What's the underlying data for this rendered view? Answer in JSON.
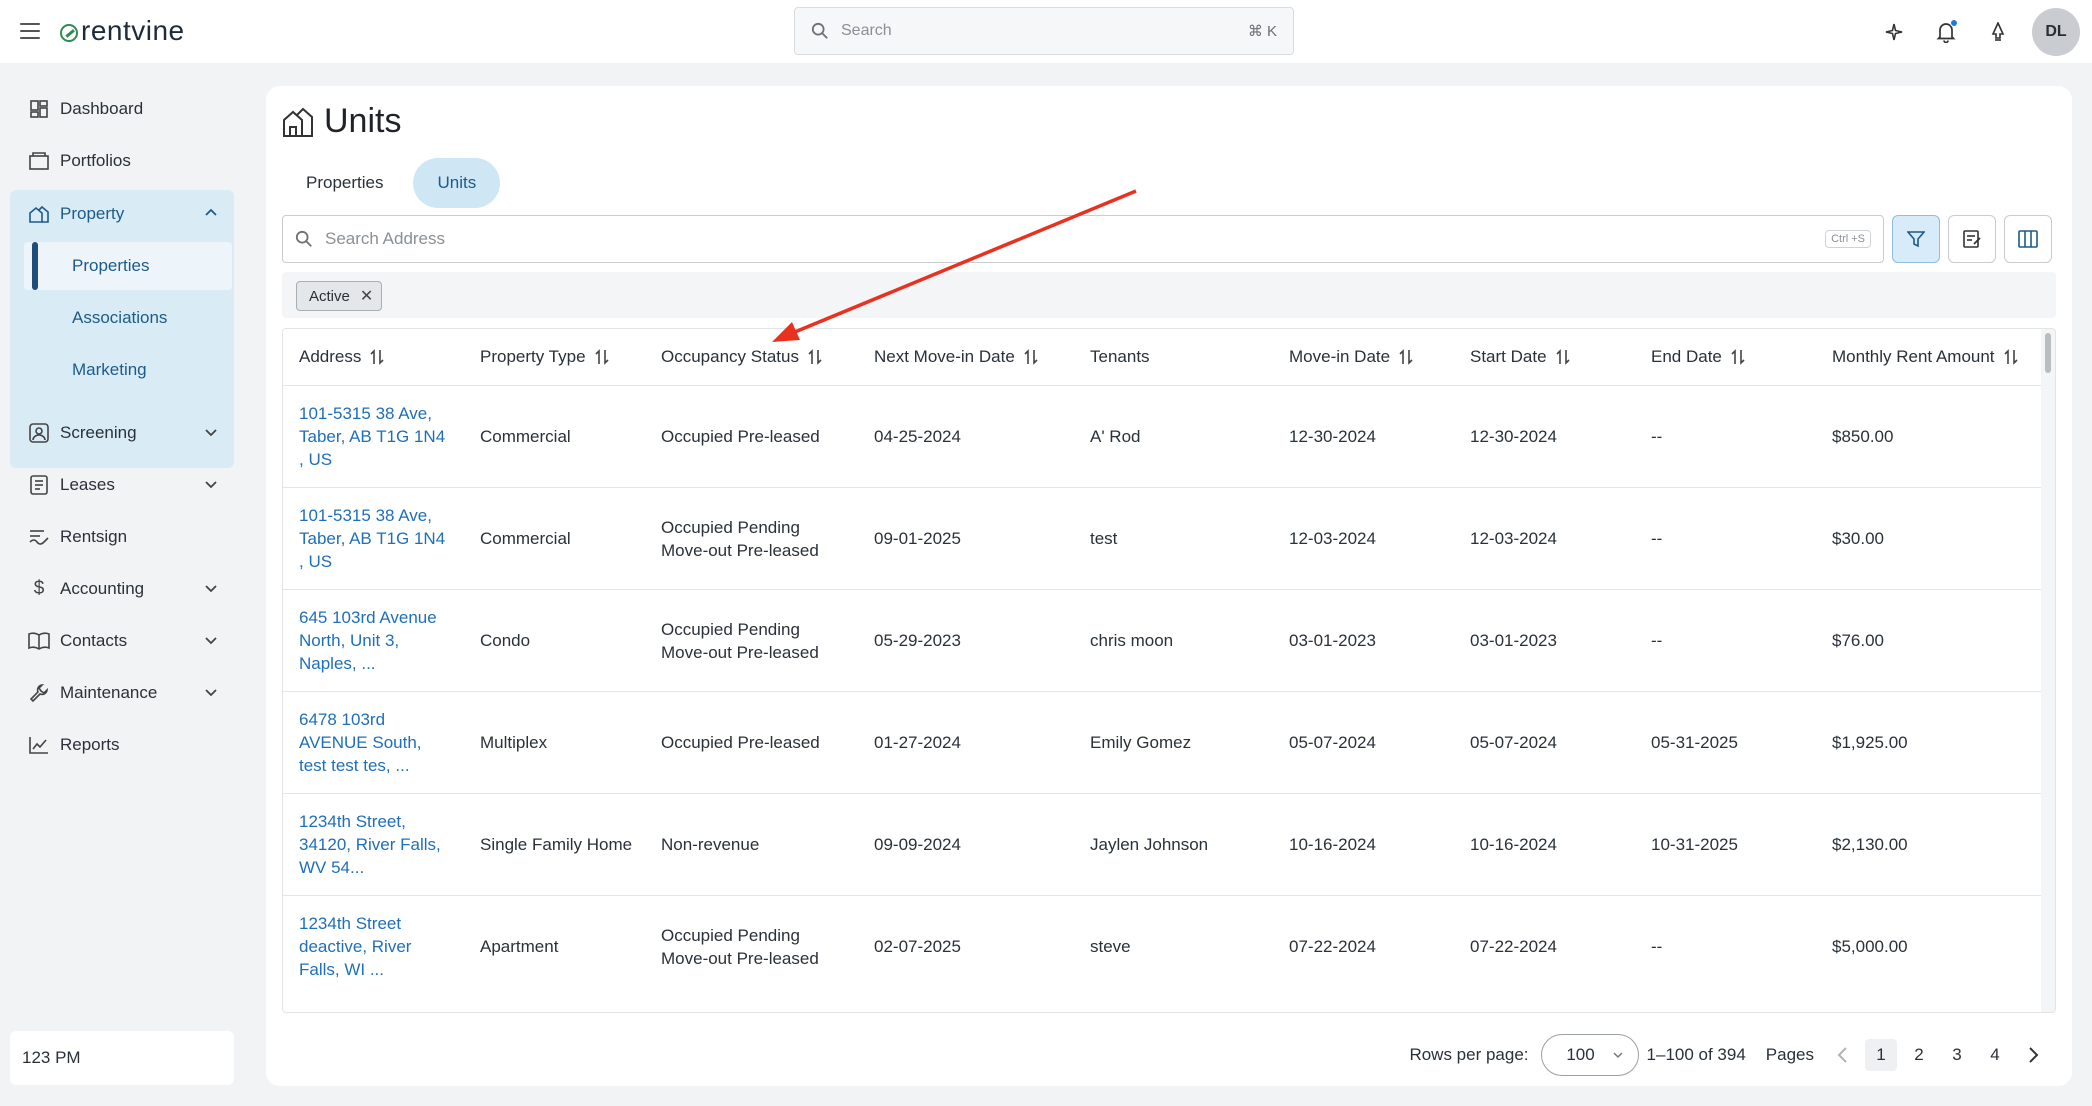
{
  "app": {
    "brand": "rentvine",
    "search_placeholder": "Search",
    "search_shortcut": "⌘ K",
    "avatar_initials": "DL"
  },
  "sidebar": {
    "items": [
      {
        "label": "Dashboard",
        "icon": "dashboard-icon"
      },
      {
        "label": "Portfolios",
        "icon": "portfolio-icon"
      },
      {
        "label": "Property",
        "icon": "property-icon",
        "expanded": true,
        "children": [
          "Properties",
          "Associations",
          "Marketing"
        ]
      },
      {
        "label": "Screening",
        "icon": "screening-icon",
        "has_chevron": true
      },
      {
        "label": "Leases",
        "icon": "leases-icon",
        "has_chevron": true
      },
      {
        "label": "Rentsign",
        "icon": "rentsign-icon"
      },
      {
        "label": "Accounting",
        "icon": "dollar-icon",
        "has_chevron": true
      },
      {
        "label": "Contacts",
        "icon": "contacts-icon",
        "has_chevron": true
      },
      {
        "label": "Maintenance",
        "icon": "wrench-icon",
        "has_chevron": true
      },
      {
        "label": "Reports",
        "icon": "reports-icon"
      }
    ],
    "active_child": "Properties",
    "user_label": "123 PM"
  },
  "page": {
    "title": "Units",
    "tabs": [
      "Properties",
      "Units"
    ],
    "active_tab": "Units",
    "search_placeholder": "Search Address",
    "search_shortcut": "Ctrl +S",
    "filter_chip": "Active"
  },
  "table": {
    "columns": [
      "Address",
      "Property Type",
      "Occupancy Status",
      "Next Move-in Date",
      "Tenants",
      "Move-in Date",
      "Start Date",
      "End Date",
      "Monthly Rent Amount"
    ],
    "sortable": [
      true,
      true,
      true,
      true,
      false,
      true,
      true,
      true,
      true
    ],
    "rows": [
      {
        "address": [
          "101-5315 38 Ave,",
          "Taber, AB T1G 1N4",
          ", US"
        ],
        "type": "Commercial",
        "status": [
          "Occupied Pre-leased"
        ],
        "next_move_in": "04-25-2024",
        "tenants": "A' Rod",
        "move_in": "12-30-2024",
        "start": "12-30-2024",
        "end": "--",
        "rent": "$850.00"
      },
      {
        "address": [
          "101-5315 38 Ave,",
          "Taber, AB T1G 1N4",
          ", US"
        ],
        "type": "Commercial",
        "status": [
          "Occupied Pending",
          "Move-out Pre-leased"
        ],
        "next_move_in": "09-01-2025",
        "tenants": "test",
        "move_in": "12-03-2024",
        "start": "12-03-2024",
        "end": "--",
        "rent": "$30.00"
      },
      {
        "address": [
          "645 103rd Avenue",
          "North, Unit 3,",
          "Naples, ..."
        ],
        "type": "Condo",
        "status": [
          "Occupied Pending",
          "Move-out Pre-leased"
        ],
        "next_move_in": "05-29-2023",
        "tenants": "chris moon",
        "move_in": "03-01-2023",
        "start": "03-01-2023",
        "end": "--",
        "rent": "$76.00"
      },
      {
        "address": [
          "6478 103rd",
          "AVENUE South,",
          "test test tes, ..."
        ],
        "type": "Multiplex",
        "status": [
          "Occupied Pre-leased"
        ],
        "next_move_in": "01-27-2024",
        "tenants": "Emily Gomez",
        "move_in": "05-07-2024",
        "start": "05-07-2024",
        "end": "05-31-2025",
        "rent": "$1,925.00"
      },
      {
        "address": [
          "1234th Street,",
          "34120, River Falls,",
          "WV 54..."
        ],
        "type": "Single Family Home",
        "status": [
          "Non-revenue"
        ],
        "next_move_in": "09-09-2024",
        "tenants": "Jaylen Johnson",
        "move_in": "10-16-2024",
        "start": "10-16-2024",
        "end": "10-31-2025",
        "rent": "$2,130.00"
      },
      {
        "address": [
          "1234th Street",
          "deactive, River",
          "Falls, WI ..."
        ],
        "type": "Apartment",
        "status": [
          "Occupied Pending",
          "Move-out Pre-leased"
        ],
        "next_move_in": "02-07-2025",
        "tenants": "steve",
        "move_in": "07-22-2024",
        "start": "07-22-2024",
        "end": "--",
        "rent": "$5,000.00"
      }
    ]
  },
  "pagination": {
    "rows_per_page_label": "Rows per page:",
    "rows_per_page": "100",
    "range": "1–100 of 394",
    "pages_label": "Pages",
    "pages": [
      "1",
      "2",
      "3",
      "4"
    ],
    "current_page": "1"
  },
  "colors": {
    "accent": "#1f6fb8",
    "sidebar_active_bg": "#d9ecf6",
    "annotation_arrow": "#e8321f"
  }
}
